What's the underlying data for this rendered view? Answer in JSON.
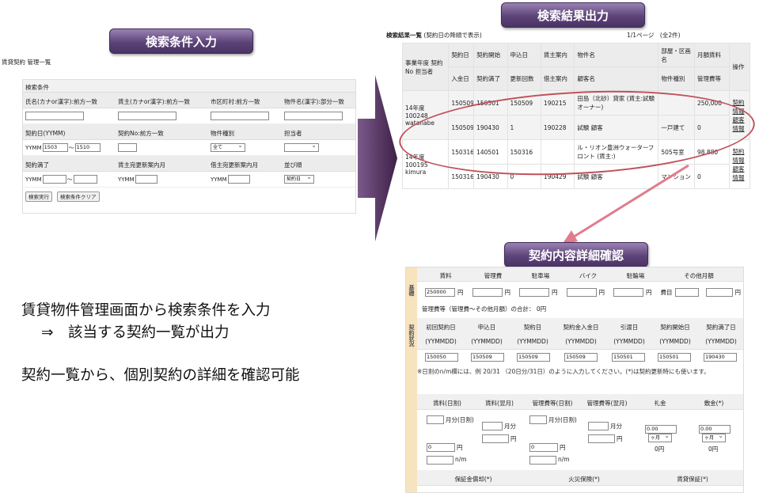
{
  "banners": {
    "search": "検索条件入力",
    "result": "検索結果出力",
    "detail": "契約内容詳細確認"
  },
  "search_panel": {
    "page_title": "賃貸契約 管理一覧",
    "header": "検索条件",
    "row1_labels": [
      "氏名(カナor漢字):前方一致",
      "賃主(カナor漢字):前方一致",
      "市区町村:前方一致",
      "物件名(漢字):部分一致"
    ],
    "row2_labels": [
      "契約日(YYMM)",
      "契約No:前方一致",
      "物件種別",
      "担当者"
    ],
    "row2": {
      "yymm_prefix": "YYMM",
      "from": "1503",
      "tilde": "～",
      "to": "1510",
      "type_value": "全て"
    },
    "row3_labels": [
      "契約満了",
      "賃主宛更新案内月",
      "借主宛更新案内月",
      "並び順"
    ],
    "row3": {
      "yymm1": "YYMM",
      "tilde": "～",
      "yymm2": "YYMM",
      "yymm3": "YYMM",
      "sort_value": "契約日"
    },
    "search_button": "検索実行",
    "clear_button": "検索条件クリア"
  },
  "results": {
    "title": "検索結果一覧",
    "subtitle": "(契約日の降順で表示)",
    "pagination": "1/1ページ　(全2件)",
    "headers": {
      "c1": "事業年度 契約No 担当者",
      "c2a": "契約日",
      "c2b": "入金日",
      "c3a": "契約開始",
      "c3b": "契約満了",
      "c4a": "申込日",
      "c4b": "更新回数",
      "c5a": "賃主案内",
      "c5b": "借主案内",
      "c6a": "物件名",
      "c6b": "顧客名",
      "c7a": "部屋・区画名",
      "c7b": "物件種別",
      "c8a": "月額賃料",
      "c8b": "管理費等",
      "c9": "操作"
    },
    "rows": [
      {
        "info": "14年度 100248 watanabe",
        "r1": [
          "150509",
          "150501",
          "150509",
          "190215",
          "田島（北砂）貸家 (賃主:試験オーナー)",
          "",
          "250,000"
        ],
        "r2": [
          "150509",
          "190430",
          "1",
          "190228",
          "試験 顧客",
          "一戸建て",
          "0"
        ],
        "ops": [
          "契約",
          "情報",
          "顧客",
          "情報"
        ]
      },
      {
        "info": "14年度 100195 kimura",
        "r1": [
          "150316",
          "140501",
          "150316",
          "",
          "ル・リオン豊洲ウォーターフロント (賃主:)",
          "505号室",
          "98,880"
        ],
        "r2": [
          "150316",
          "190430",
          "0",
          "190429",
          "試験 顧客",
          "マンション",
          "0"
        ],
        "ops": [
          "契約",
          "情報",
          "顧客",
          "情報"
        ]
      }
    ]
  },
  "detail": {
    "side_labels": [
      "基礎",
      "契約状況"
    ],
    "fees_headers": [
      "賃料",
      "管理費",
      "駐車場",
      "バイク",
      "駐輪場",
      "その他月額"
    ],
    "fees_values": {
      "rent": "250000",
      "yen": "円",
      "other_label": "費目"
    },
    "total_line": "管理費等（管理費～その他月額）の合計： 0円",
    "date_headers": [
      "初回契約日",
      "申込日",
      "契約日",
      "契約金入金日",
      "引渡日",
      "契約開始日",
      "契約満了日"
    ],
    "date_format": "(YYMMDD)",
    "date_values": [
      "150050",
      "150509",
      "150509",
      "150509",
      "150501",
      "150501",
      "190430"
    ],
    "note": "※日割のn/m欄には、例 20/31 （20日分/31日）のように入力してください。(*)は契約更新時にも使います。",
    "prorate_headers": [
      "賃料(日割)",
      "賃料(翌月)",
      "管理費等(日割)",
      "管理費等(翌月)",
      "礼金",
      "敷金(*)"
    ],
    "prorate": {
      "month_day": "月分(日割)",
      "month": "月分",
      "zero": "0",
      "yen": "円",
      "nm": "n/m",
      "zero_dec": "0.00",
      "months": "ヶ月",
      "zero_yen": "0円"
    },
    "bottom_headers": [
      "保証金償却(*)",
      "火災保険(*)",
      "賃貸保証(*)"
    ]
  },
  "captions": {
    "line1": "賃貸物件管理画面から検索条件を入力",
    "line2": "⇒　該当する契約一覧が出力",
    "line3": "契約一覧から、個別契約の詳細を確認可能"
  },
  "colors": {
    "banner": "#5d4478",
    "arrow": "#4a2a55",
    "ellipse": "#c0505a",
    "pink_arrow": "#e07c8c",
    "side_bar": "#f7e3bd"
  }
}
